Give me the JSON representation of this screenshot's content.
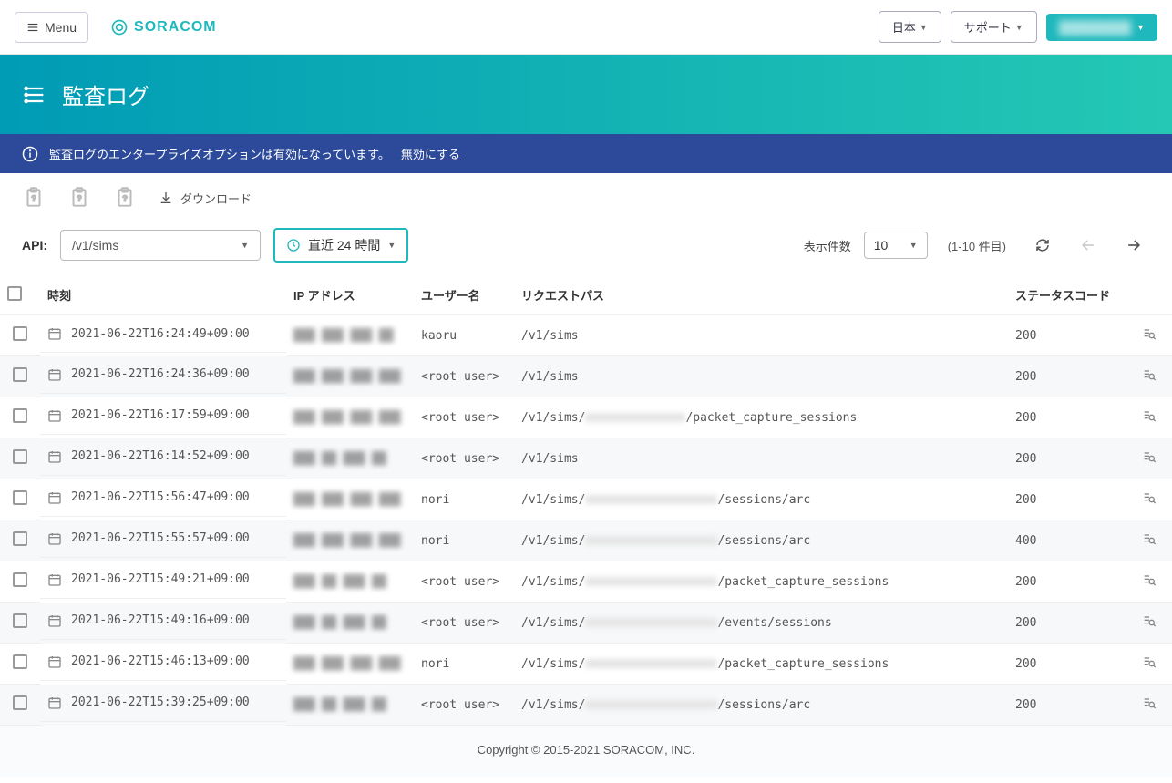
{
  "topnav": {
    "menu_label": "Menu",
    "brand": "SORACOM",
    "locale_label": "日本",
    "support_label": "サポート",
    "user_label": "████████"
  },
  "banner": {
    "title": "監査ログ"
  },
  "info_bar": {
    "text": "監査ログのエンタープライズオプションは有効になっています。",
    "link_label": "無効にする"
  },
  "toolbar": {
    "download_label": "ダウンロード"
  },
  "filter": {
    "api_label": "API:",
    "api_value": "/v1/sims",
    "time_value": "直近 24 時間",
    "page_size_label": "表示件数",
    "page_size_value": "10",
    "page_range": "(1-10 件目)"
  },
  "table": {
    "headers": {
      "time": "時刻",
      "ip": "IP アドレス",
      "user": "ユーザー名",
      "path": "リクエストパス",
      "status": "ステータスコード"
    },
    "rows": [
      {
        "time": "2021-06-22T16:24:49+09:00",
        "ip": "███ ███ ███  ██",
        "user": "kaoru",
        "path_prefix": "/v1/sims",
        "path_suffix": "",
        "has_mask": false,
        "mask_w": 0,
        "status": "200"
      },
      {
        "time": "2021-06-22T16:24:36+09:00",
        "ip": "███  ███  ███  ███",
        "user": "<root user>",
        "path_prefix": "/v1/sims",
        "path_suffix": "",
        "has_mask": false,
        "mask_w": 0,
        "status": "200"
      },
      {
        "time": "2021-06-22T16:17:59+09:00",
        "ip": "███  ███  ███  ███",
        "user": "<root user>",
        "path_prefix": "/v1/sims/",
        "path_suffix": "/packet_capture_sessions",
        "has_mask": true,
        "mask_w": 110,
        "status": "200"
      },
      {
        "time": "2021-06-22T16:14:52+09:00",
        "ip": "███  ██  ███  ██",
        "user": "<root user>",
        "path_prefix": "/v1/sims",
        "path_suffix": "",
        "has_mask": false,
        "mask_w": 0,
        "status": "200"
      },
      {
        "time": "2021-06-22T15:56:47+09:00",
        "ip": "███  ███  ███  ███",
        "user": "nori",
        "path_prefix": "/v1/sims/",
        "path_suffix": "/sessions/arc",
        "has_mask": true,
        "mask_w": 145,
        "status": "200"
      },
      {
        "time": "2021-06-22T15:55:57+09:00",
        "ip": "███  ███  ███  ███",
        "user": "nori",
        "path_prefix": "/v1/sims/",
        "path_suffix": "/sessions/arc",
        "has_mask": true,
        "mask_w": 145,
        "status": "400"
      },
      {
        "time": "2021-06-22T15:49:21+09:00",
        "ip": "███  ██  ███  ██",
        "user": "<root user>",
        "path_prefix": "/v1/sims/",
        "path_suffix": "/packet_capture_sessions",
        "has_mask": true,
        "mask_w": 145,
        "status": "200"
      },
      {
        "time": "2021-06-22T15:49:16+09:00",
        "ip": "███  ██  ███  ██",
        "user": "<root user>",
        "path_prefix": "/v1/sims/",
        "path_suffix": "/events/sessions",
        "has_mask": true,
        "mask_w": 145,
        "status": "200"
      },
      {
        "time": "2021-06-22T15:46:13+09:00",
        "ip": "███  ███  ███  ███",
        "user": "nori",
        "path_prefix": "/v1/sims/",
        "path_suffix": "/packet_capture_sessions",
        "has_mask": true,
        "mask_w": 145,
        "status": "200"
      },
      {
        "time": "2021-06-22T15:39:25+09:00",
        "ip": "███  ██  ███  ██",
        "user": "<root user>",
        "path_prefix": "/v1/sims/",
        "path_suffix": "/sessions/arc",
        "has_mask": true,
        "mask_w": 145,
        "status": "200"
      }
    ]
  },
  "footer": {
    "text": "Copyright © 2015-2021 SORACOM, INC."
  }
}
